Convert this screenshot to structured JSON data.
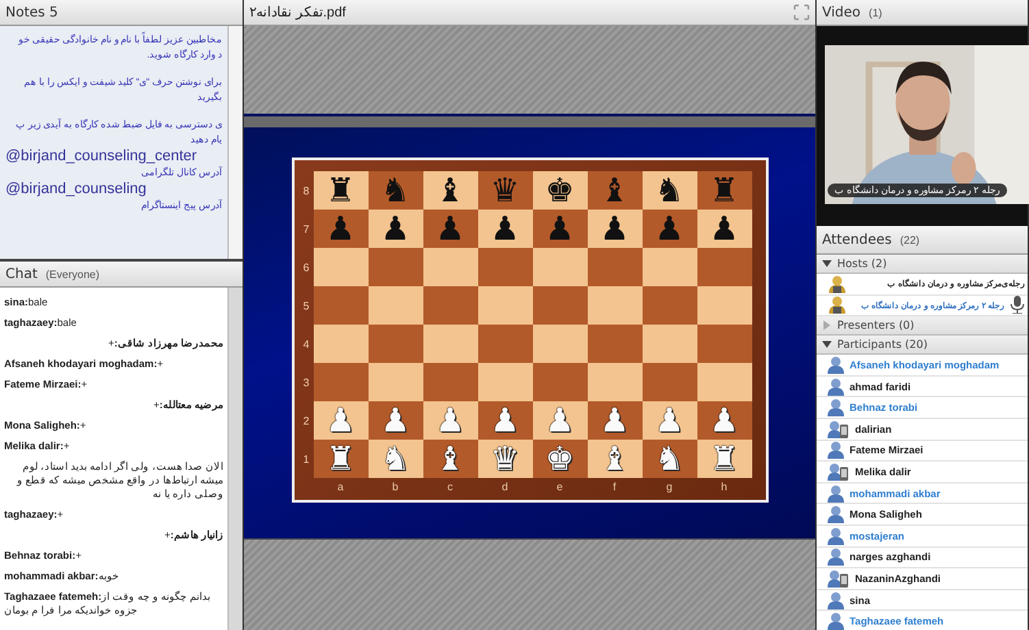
{
  "notes": {
    "title": "Notes 5",
    "paragraphs": [
      {
        "lines": [
          {
            "kind": "text",
            "text": "مخاطبین عزیز لطفاً با نام و نام خانوادگی حقیقی خو"
          },
          {
            "kind": "text",
            "text": "د وارد کارگاه شوید."
          }
        ]
      },
      {
        "lines": [
          {
            "kind": "text",
            "text": "برای نوشتن حرف \"ی\" کلید شیفت و ایکس را با هم"
          },
          {
            "kind": "text",
            "text": "بگیرید"
          }
        ]
      },
      {
        "lines": [
          {
            "kind": "text",
            "text": "ی دسترسی به فایل ضبط شده کارگاه به آیدی زیر پ"
          },
          {
            "kind": "text",
            "text": "یام دهید"
          },
          {
            "kind": "handle",
            "text": "@birjand_counseling_center"
          },
          {
            "kind": "text",
            "text": "آدرس کانال تلگرامی"
          },
          {
            "kind": "handle",
            "text": "@birjand_counseling"
          },
          {
            "kind": "text",
            "text": "آدرس پیج اینستاگرام"
          }
        ]
      }
    ]
  },
  "chat": {
    "title": "Chat",
    "audience": "(Everyone)",
    "messages": [
      {
        "sender": "sina:",
        "text": "bale"
      },
      {
        "sender": "taghazaey:",
        "text": "bale"
      },
      {
        "sender": "محمدرضا مهرزاد شاقی:",
        "text": "+"
      },
      {
        "sender": "Afsaneh khodayari moghadam:",
        "text": "+"
      },
      {
        "sender": "Fateme Mirzaei:",
        "text": "+"
      },
      {
        "sender": "مرضیه معتالله:",
        "text": "+"
      },
      {
        "sender": "Mona Saligheh:",
        "text": "+"
      },
      {
        "sender": "Melika dalir:",
        "text": "+"
      },
      {
        "text": "الان صدا هست، ولی اگر ادامه بدید استاد، لوم میشه ارتباط‌ها در واقع مشخص میشه که قطع و وصلی داره یا نه"
      },
      {
        "sender": "taghazaey:",
        "text": "+"
      },
      {
        "sender": "زانیار هاشم:",
        "text": "+"
      },
      {
        "sender": "Behnaz torabi:",
        "text": "+"
      },
      {
        "sender": "mohammadi akbar:",
        "text": "خوبه"
      },
      {
        "sender": "Taghazaee fatemeh:",
        "text": "بدانم چگونه و چه وقت از جزوه خواندیکه مرا فرا م بومان"
      }
    ]
  },
  "document": {
    "title": "تفکر نقادانه۲.pdf",
    "board": {
      "ranks": [
        {
          "label": "8",
          "kind": "black",
          "pieces": [
            "♜",
            "♞",
            "♝",
            "♚",
            "♛",
            "♝",
            "♞",
            "♜"
          ]
        },
        {
          "label": "7",
          "kind": "black",
          "pieces": [
            "♟",
            "♟",
            "♟",
            "♟",
            "♟",
            "♟",
            "♟",
            "♟"
          ]
        },
        {
          "label": "6"
        },
        {
          "label": "5"
        },
        {
          "label": "4"
        },
        {
          "label": "3"
        },
        {
          "label": "2",
          "kind": "white",
          "pieces": [
            "♟",
            "♟",
            "♟",
            "♟",
            "♟",
            "♟",
            "♟",
            "♟"
          ]
        },
        {
          "label": "1",
          "kind": "white",
          "pieces": [
            "♜",
            "♞",
            "♝",
            "♚",
            "♛",
            "♝",
            "♞",
            "♜"
          ]
        }
      ],
      "files": [
        "h",
        "g",
        "f",
        "e",
        "d",
        "c",
        "b",
        "a"
      ]
    }
  },
  "video": {
    "title": "Video",
    "count": "(1)",
    "caption": "رجله ۲ رمرکز مشاوره و درمان دانشگاه ب"
  },
  "attendees": {
    "title": "Attendees",
    "count": "(22)",
    "groups": [
      {
        "label": "Hosts (2)",
        "expanded": true,
        "people": [
          {
            "name": "رجله‌ی‌مرکز مشاوره و درمان دانشگاه ب",
            "color": "#222222",
            "kind": "host",
            "speaking": false
          },
          {
            "name": "رجله ۲ رمرکز مشاوره و درمان دانشگاه ب",
            "color": "#2f6fc0",
            "kind": "host",
            "speaking": true
          }
        ]
      },
      {
        "label": "Presenters (0)",
        "expanded": false
      },
      {
        "label": "Participants (20)",
        "expanded": true,
        "people": [
          {
            "name": "Afsaneh khodayari moghadam",
            "color": "#2f7fd0",
            "kind": "user"
          },
          {
            "name": "ahmad faridi",
            "color": "#222222",
            "kind": "user"
          },
          {
            "name": "Behnaz torabi",
            "color": "#2f7fd0",
            "kind": "user"
          },
          {
            "name": "dalirian",
            "color": "#222222",
            "kind": "mobile"
          },
          {
            "name": "Fateme Mirzaei",
            "color": "#222222",
            "kind": "user"
          },
          {
            "name": "Melika dalir",
            "color": "#222222",
            "kind": "mobile"
          },
          {
            "name": "mohammadi akbar",
            "color": "#2f7fd0",
            "kind": "user"
          },
          {
            "name": "Mona Saligheh",
            "color": "#222222",
            "kind": "user"
          },
          {
            "name": "mostajeran",
            "color": "#2f7fd0",
            "kind": "user"
          },
          {
            "name": "narges azghandi",
            "color": "#222222",
            "kind": "user"
          },
          {
            "name": "NazaninAzghandi",
            "color": "#222222",
            "kind": "mobile"
          },
          {
            "name": "sina",
            "color": "#222222",
            "kind": "user"
          },
          {
            "name": "Taghazaee fatemeh",
            "color": "#2f7fd0",
            "kind": "user"
          }
        ]
      }
    ]
  }
}
